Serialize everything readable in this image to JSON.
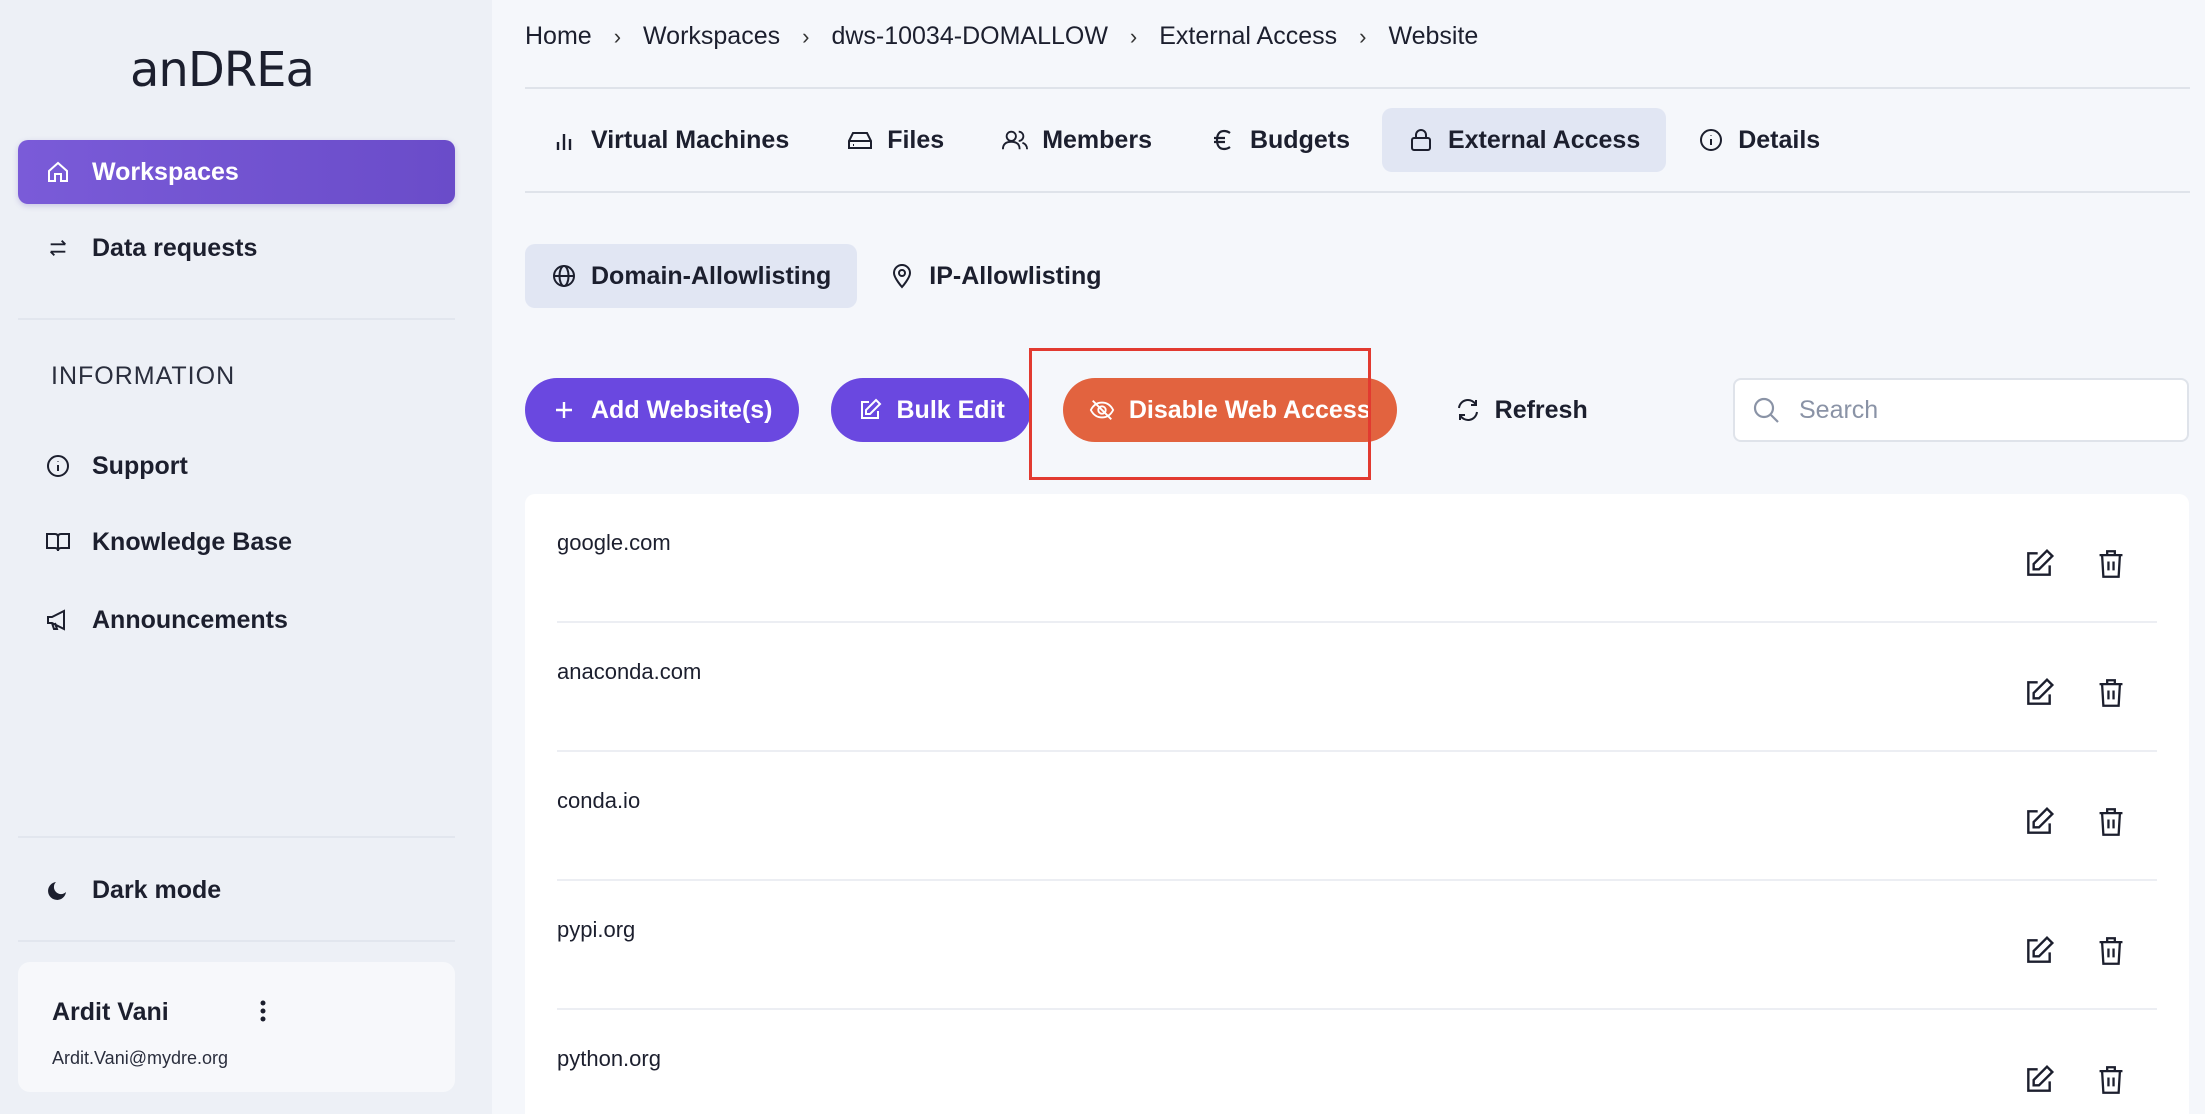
{
  "app": {
    "logo_text": "anDREa"
  },
  "sidebar": {
    "nav": [
      {
        "label": "Workspaces",
        "icon": "home-icon",
        "active": true
      },
      {
        "label": "Data requests",
        "icon": "swap-arrows-icon",
        "active": false
      }
    ],
    "section_title": "INFORMATION",
    "info_items": [
      {
        "label": "Support",
        "icon": "info-icon"
      },
      {
        "label": "Knowledge Base",
        "icon": "book-icon"
      },
      {
        "label": "Announcements",
        "icon": "megaphone-icon"
      }
    ],
    "dark_mode_label": "Dark mode",
    "user": {
      "name": "Ardit Vani",
      "email": "Ardit.Vani@mydre.org"
    }
  },
  "breadcrumb": [
    "Home",
    "Workspaces",
    "dws-10034-DOMALLOW",
    "External Access",
    "Website"
  ],
  "tabs": [
    {
      "label": "Virtual Machines",
      "icon": "bar-chart-icon",
      "active": false
    },
    {
      "label": "Files",
      "icon": "drive-icon",
      "active": false
    },
    {
      "label": "Members",
      "icon": "users-icon",
      "active": false
    },
    {
      "label": "Budgets",
      "icon": "euro-icon",
      "active": false
    },
    {
      "label": "External Access",
      "icon": "lock-icon",
      "active": true
    },
    {
      "label": "Details",
      "icon": "info-icon",
      "active": false
    }
  ],
  "subtabs": [
    {
      "label": "Domain-Allowlisting",
      "icon": "globe-icon",
      "active": true
    },
    {
      "label": "IP-Allowlisting",
      "icon": "map-pin-icon",
      "active": false
    }
  ],
  "actions": {
    "add_label": "Add Website(s)",
    "bulk_edit_label": "Bulk Edit",
    "disable_label": "Disable Web Access",
    "refresh_label": "Refresh"
  },
  "search": {
    "placeholder": "Search",
    "value": ""
  },
  "domains": [
    "google.com",
    "anaconda.com",
    "conda.io",
    "pypi.org",
    "python.org"
  ],
  "colors": {
    "primary": "#6a48e0",
    "danger": "#e2633f",
    "highlight": "#e23a30"
  }
}
